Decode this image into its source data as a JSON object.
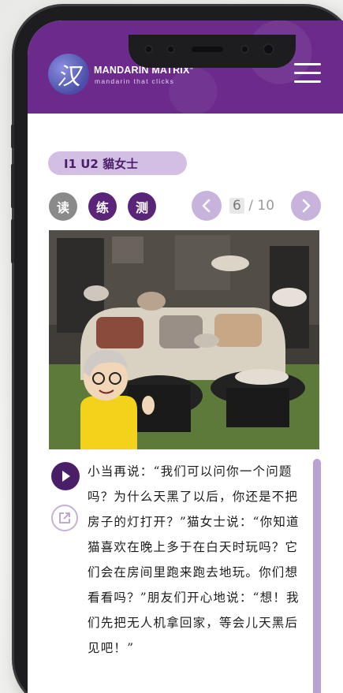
{
  "header": {
    "logo_glyph": "汉",
    "brand_name": "MANDARIN MATRIX",
    "brand_tag": "mandarin that clicks",
    "menu_icon": "hamburger-icon"
  },
  "lesson": {
    "tag": "I1 U2 貓女士"
  },
  "modes": [
    {
      "label": "读",
      "color": "#8a8a8a"
    },
    {
      "label": "练",
      "color": "#5a2479"
    },
    {
      "label": "测",
      "color": "#5a2479"
    }
  ],
  "pager": {
    "current": "6",
    "separator": "/",
    "total": "10"
  },
  "colors": {
    "primary": "#6b2a8c",
    "accent": "#c7b3dc",
    "dark": "#4b1f68"
  },
  "story": {
    "text": "小当再说：“我们可以问你一个问题吗？为什么天黑了以后，你还是不把房子的灯打开？”猫女士说：“你知道猫喜欢在晚上多于在白天时玩吗？它们会在房间里跑来跑去地玩。你们想看看吗？”朋友们开心地说：“想！我们先把无人机拿回家，等会儿天黑后见吧！”"
  }
}
